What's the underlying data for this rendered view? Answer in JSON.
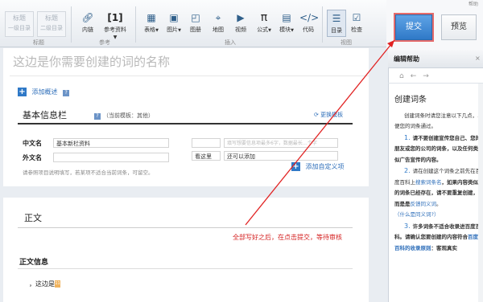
{
  "toolbar": {
    "heading1_label": "标题",
    "heading1_sub": "一级目录",
    "heading2_label": "标题",
    "heading2_sub": "二级目录",
    "heading_group": "标题",
    "inner_link": "内链",
    "reference": "参考资料",
    "reference_icon": "[1]",
    "ref_group": "参考",
    "table": "表格",
    "image": "图片",
    "gallery": "图册",
    "map": "地图",
    "video": "视频",
    "formula": "公式",
    "module": "模块",
    "code": "代码",
    "insert_group": "插入",
    "toc": "目录",
    "check": "检查",
    "view_group": "视图"
  },
  "top_right": {
    "submit": "提交",
    "preview": "预览",
    "help_link": "帮助"
  },
  "editor": {
    "title_placeholder": "这边是你需要创建的词的名称",
    "add_summary": "添加概述",
    "basic_title": "基本信息栏",
    "basic_sub": "（当前模板：其他）",
    "change_template": "更换模板",
    "fields": [
      {
        "label": "中文名",
        "value": "基本新栏资料"
      },
      {
        "label": "外文名",
        "value": ""
      }
    ],
    "right_fields": [
      {
        "label": "",
        "value": "",
        "placeholder": "填写想要信息项最多6字，数据最长…个字"
      },
      {
        "label": "看这里",
        "value": "还可以添加"
      }
    ],
    "note": "请参照项目说明填写，若某项不适合当前词条，可留空。",
    "add_custom": "添加自定义项",
    "body_title": "正文",
    "annotation": "全部写好之后，在点击提交，等待审核",
    "body_info": "正文信息",
    "body_text": "，这边是",
    "cursor_mark": "11"
  },
  "help": {
    "header": "编辑帮助",
    "heading": "创建词条",
    "p0": "创建词条时请您注意以下几点，以便您的词条通过。",
    "p1_num": "1.",
    "p1": "请不要创建宣传您自己、您的朋友或您的公司的词条，以及任何类似广告宣传的内容。",
    "p2_num": "2.",
    "p2a": "请在创建这个词条之前先在百度百科上",
    "p2_link": "搜索词条名",
    "p2b": "，如果内容类似的词条已经存在，请不要重复创建，而是是",
    "p2_link2": "反馈同义词",
    "p2c": "。",
    "p2_q": "（什么是同义词?）",
    "p3_num": "3.",
    "p3a": "许多词条不适合收录进百度百科。请确认您要创建的内容符合",
    "p3_link": "百度百科的收录原则",
    "p3b": "：客观真实"
  },
  "colors": {
    "accent": "#2f79c7",
    "annotation": "#d42020",
    "highlight_box": "#e56b6b"
  }
}
